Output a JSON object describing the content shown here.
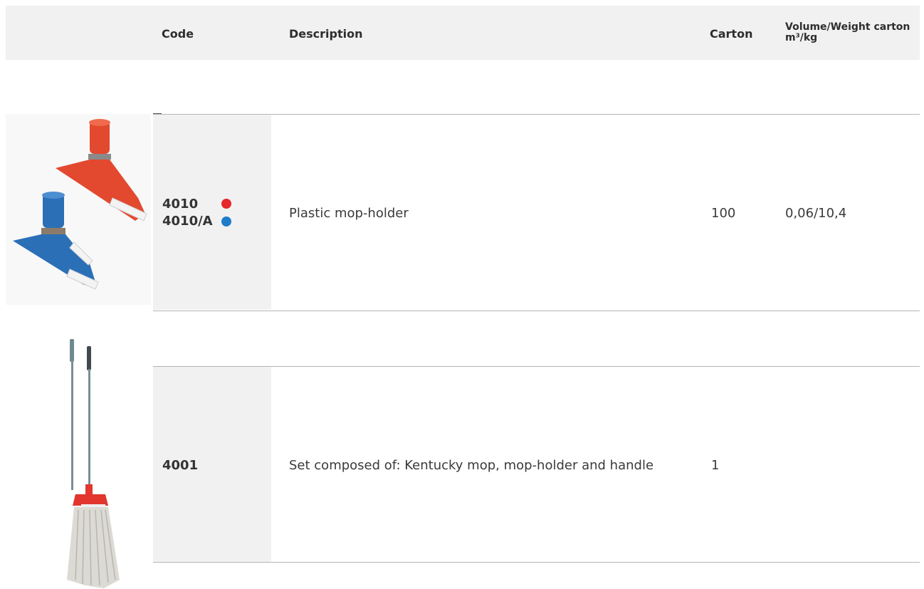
{
  "header": {
    "code": "Code",
    "description": "Description",
    "carton": "Carton",
    "volume_line1": "Volume/Weight carton",
    "volume_line2": "m³/kg"
  },
  "rows": [
    {
      "codes": [
        {
          "label": "4010",
          "color_dot": "#e5262b"
        },
        {
          "label": "4010/A",
          "color_dot": "#1f7cc8"
        }
      ],
      "description": "Plastic mop-holder",
      "carton": "100",
      "volume_weight": "0,06/10,4",
      "image": "mop-holders-red-blue"
    },
    {
      "codes": [
        {
          "label": "4001"
        }
      ],
      "description": "Set composed of: Kentucky mop, mop-holder and handle",
      "carton": "1",
      "volume_weight": "",
      "image": "kentucky-mop-set"
    }
  ]
}
